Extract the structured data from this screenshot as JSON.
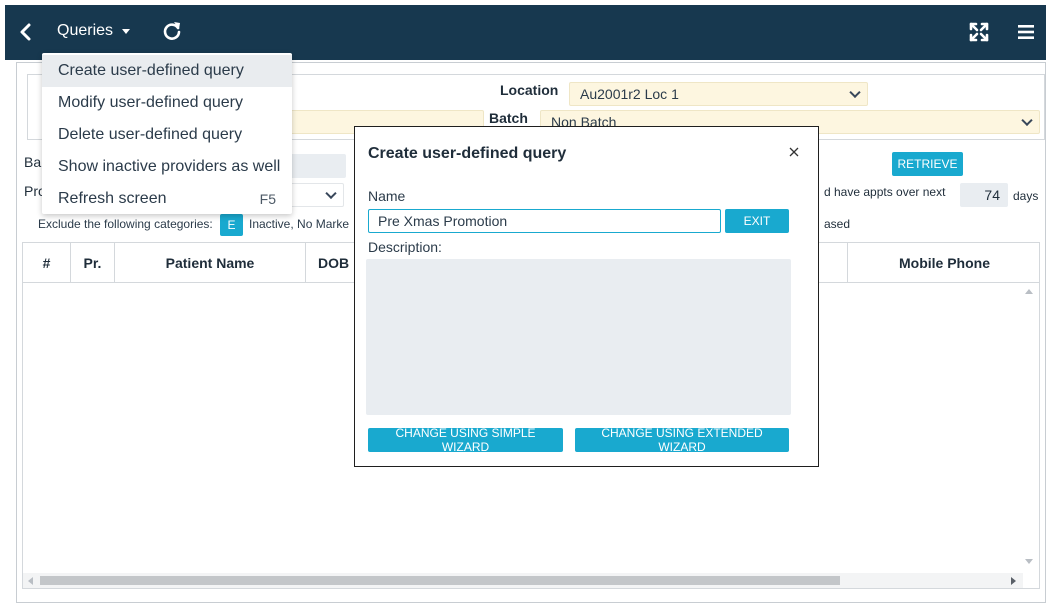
{
  "toolbar": {
    "back_icon": "chevron-left-icon",
    "menu_label": "Queries",
    "refresh_icon": "refresh-icon",
    "expand_icon": "expand-icon",
    "menu_icon": "hamburger-icon"
  },
  "dropdown": {
    "items": [
      {
        "label": "Create user-defined query",
        "shortcut": ""
      },
      {
        "label": "Modify user-defined query",
        "shortcut": ""
      },
      {
        "label": "Delete user-defined query",
        "shortcut": ""
      },
      {
        "label": "Show inactive providers as well",
        "shortcut": ""
      },
      {
        "label": "Refresh screen",
        "shortcut": "F5"
      }
    ]
  },
  "filters": {
    "location_label": "Location",
    "location_value": "Au2001r2 Loc 1",
    "batch_label": "Batch",
    "batch_value": "Non Batch",
    "ba_label": "Ba",
    "pro_label": "Pro",
    "retrieve_label": "RETRIEVE",
    "appts_text": "d have appts over next",
    "days_value": "74",
    "days_unit": "days",
    "exclude_label": "Exclude the following categories:",
    "exclude_chip": "E",
    "exclude_categories": "Inactive, No Marke",
    "deceased_fragment": "ased"
  },
  "grid": {
    "columns": [
      "#",
      "Pr.",
      "Patient Name",
      "DOB",
      "Mobile Phone"
    ]
  },
  "dialog": {
    "title": "Create user-defined query",
    "name_label": "Name",
    "name_value": "Pre Xmas Promotion",
    "exit_label": "EXIT",
    "description_label": "Description:",
    "description_value": "",
    "simple_wizard_label": "CHANGE USING SIMPLE WIZARD",
    "extended_wizard_label": "CHANGE USING EXTENDED WIZARD"
  },
  "colors": {
    "header_bg": "#17384f",
    "accent": "#19a9cf",
    "select_bg": "#fdf6e0",
    "input_bg": "#e9edf1"
  }
}
